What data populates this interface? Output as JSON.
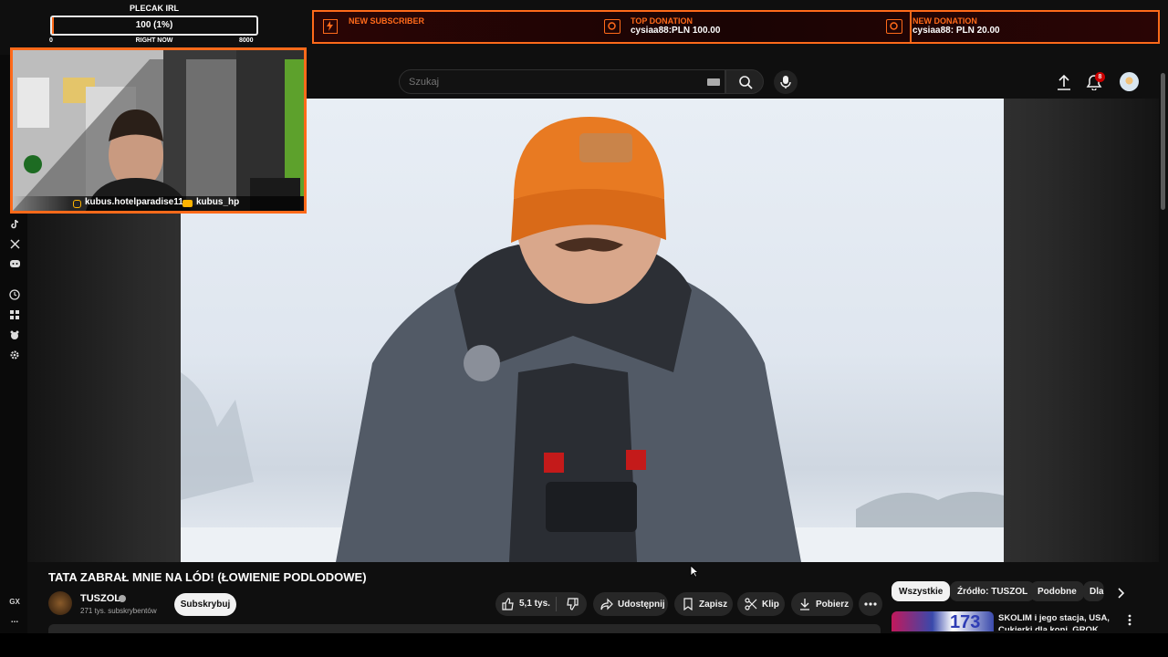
{
  "overlay": {
    "plecak": {
      "title": "PLECAK IRL",
      "progress_text": "100 (1%)",
      "progress_fraction": 0.01,
      "min": "0",
      "mid": "RIGHT NOW",
      "max": "8000"
    },
    "alerts": [
      {
        "label": "NEW SUBSCRIBER",
        "value": ""
      },
      {
        "label": "TOP DONATION",
        "value": "cysiaa88:PLN 100.00"
      },
      {
        "label": "NEW DONATION",
        "value": "cysiaa88: PLN 20.00"
      }
    ],
    "socials": {
      "instagram": "kubus.hotelparadise11",
      "youtube": "kubus_hp"
    },
    "accent": "#ff6a1a"
  },
  "browser": {
    "gx_label": "GX",
    "more": "..."
  },
  "header": {
    "search_placeholder": "Szukaj",
    "notification_count": "8"
  },
  "video": {
    "title": "TATA ZABRAŁ MNIE NA LÓD! (ŁOWIENIE PODLODOWE)"
  },
  "channel": {
    "name": "TUSZOL",
    "subs": "271 tys. subskrybentów",
    "subscribe_label": "Subskrybuj"
  },
  "actions": {
    "likes": "5,1 tys.",
    "share": "Udostępnij",
    "save": "Zapisz",
    "clip": "Klip",
    "download": "Pobierz"
  },
  "chips": [
    "Wszystkie",
    "Źródło: TUSZOL",
    "Podobne",
    "Dla"
  ],
  "recommendation": {
    "title_line1": "SKOLIM i jego stacja, USA,",
    "title_line2": "Cukierki dla koni, GROK",
    "thumb_number": "173"
  }
}
